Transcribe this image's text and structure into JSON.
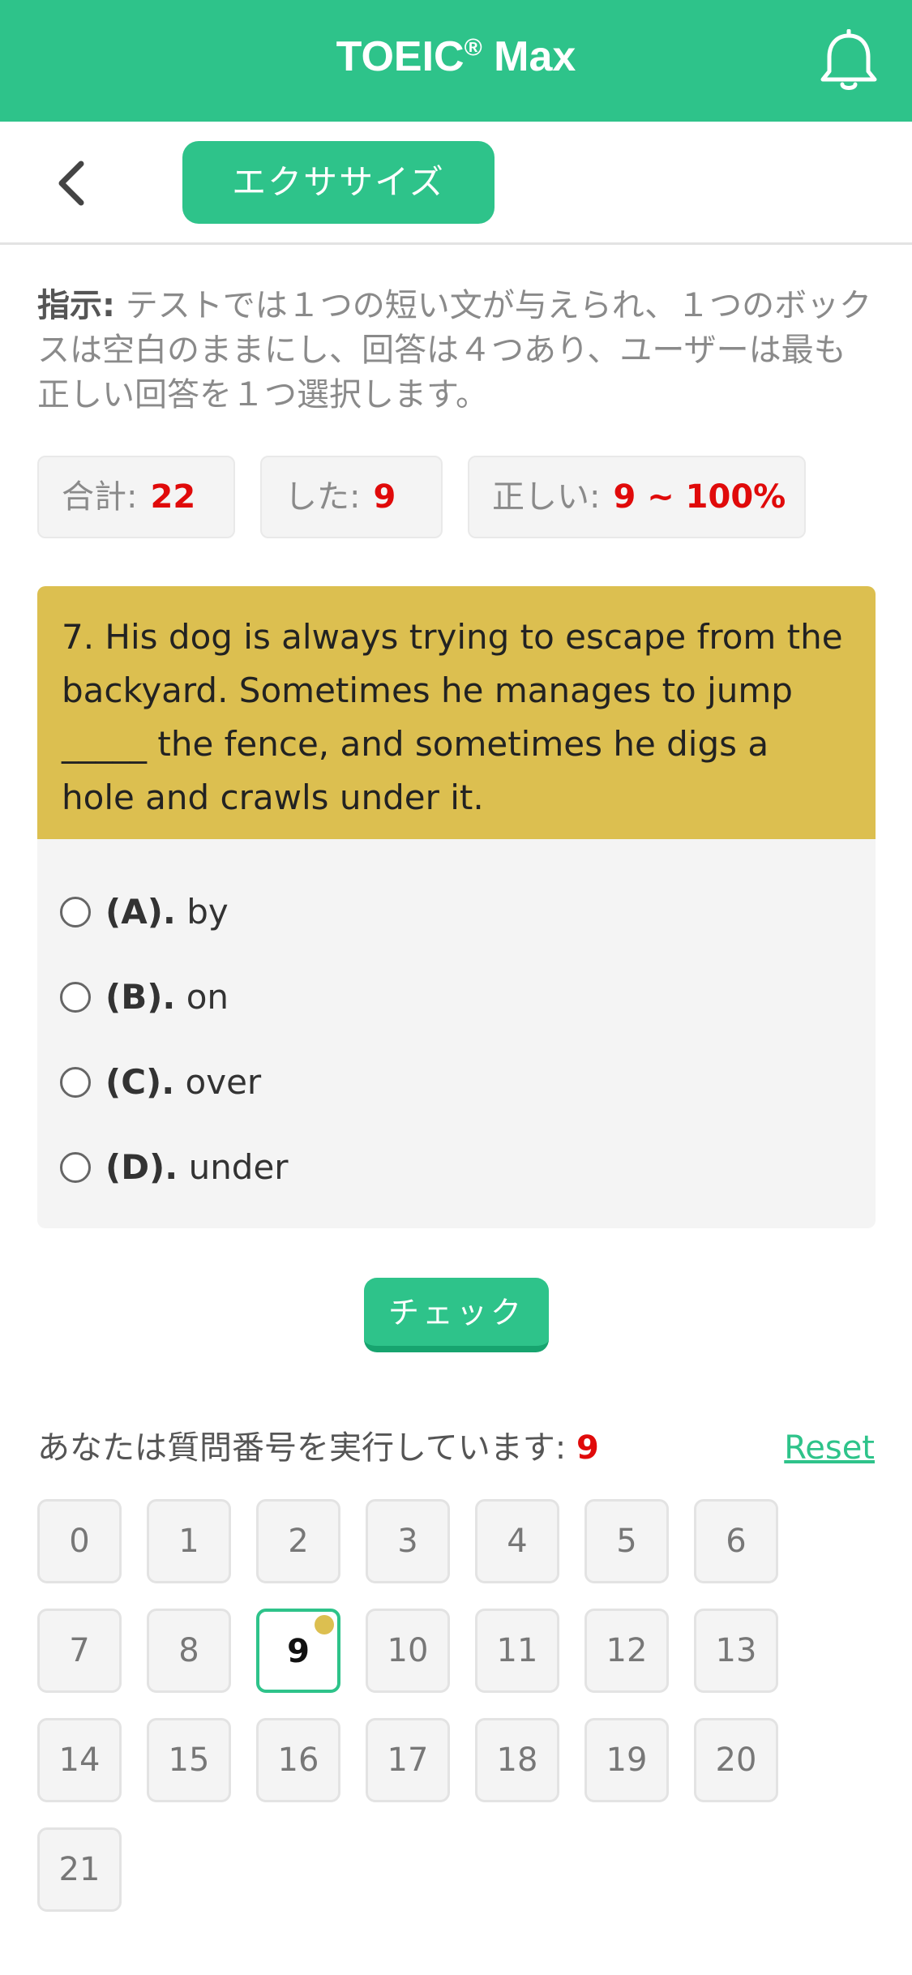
{
  "header": {
    "title": "TOEIC",
    "title_mark": "®",
    "title_suffix": " Max",
    "icon": "bell-icon",
    "color": "#2EC38A"
  },
  "subheader": {
    "back_icon": "chevron-left-icon",
    "tab_label": "エクササイズ"
  },
  "instruction": {
    "label": "指示:",
    "text": " テストでは１つの短い文が与えられ、１つのボックスは空白のままにし、回答は４つあり、ユーザーは最も正しい回答を１つ選択します。"
  },
  "stats": {
    "total_label": "合計:",
    "total_value": "22",
    "done_label": "した:",
    "done_value": "9",
    "correct_label": "正しい:",
    "correct_value": "9 ~ 100%"
  },
  "question": {
    "text": "7. His dog is always trying to escape from the backyard. Sometimes he manages to jump _____ the fence, and sometimes he digs a hole and crawls under it.",
    "bg_color": "#DCBF50",
    "options": [
      {
        "label": "(A).",
        "text": " by"
      },
      {
        "label": "(B).",
        "text": " on"
      },
      {
        "label": "(C).",
        "text": " over"
      },
      {
        "label": "(D).",
        "text": " under"
      }
    ]
  },
  "check_button": "チェック",
  "progress": {
    "running_label": "あなたは質問番号を実行しています: ",
    "current": "9",
    "reset_label": "Reset",
    "numbers": [
      "0",
      "1",
      "2",
      "3",
      "4",
      "5",
      "6",
      "7",
      "8",
      "9",
      "10",
      "11",
      "12",
      "13",
      "14",
      "15",
      "16",
      "17",
      "18",
      "19",
      "20",
      "21"
    ],
    "active_index": 9
  }
}
